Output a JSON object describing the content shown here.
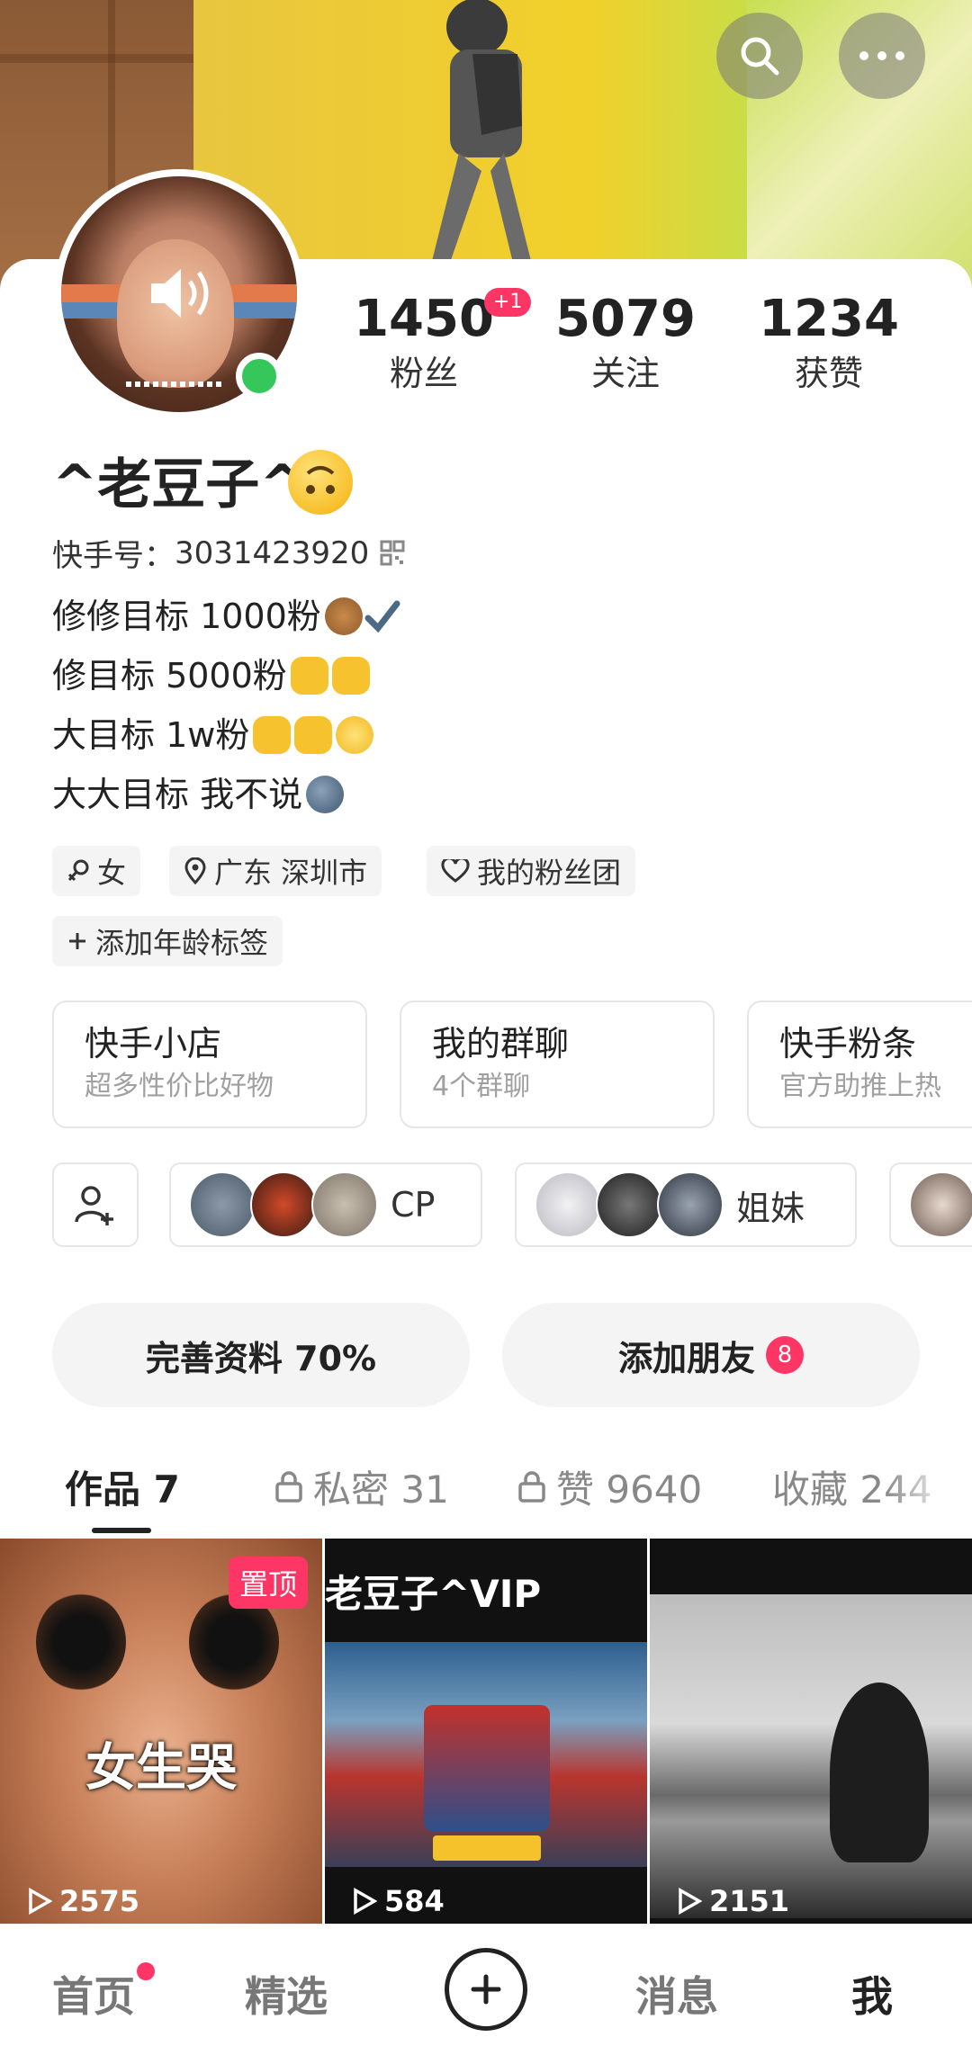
{
  "header": {
    "search_icon": "search-icon",
    "more_icon": "more-dots-icon"
  },
  "profile": {
    "nickname": "^老豆子^",
    "kuaishou_id_label": "快手号：",
    "kuaishou_id": "3031423920",
    "online": true
  },
  "stats": {
    "fans": {
      "value": "1450",
      "label": "粉丝",
      "badge": "+1"
    },
    "following": {
      "value": "5079",
      "label": "关注"
    },
    "likes": {
      "value": "1234",
      "label": "获赞"
    }
  },
  "bio": [
    "修修目标 1000粉",
    "修目标 5000粉",
    "大目标 1w粉",
    "大大目标 我不说"
  ],
  "tags": {
    "gender": "女",
    "location": "广东 深圳市",
    "fan_group": "我的粉丝团",
    "add_age": "添加年龄标签"
  },
  "services": [
    {
      "title": "快手小店",
      "subtitle": "超多性价比好物"
    },
    {
      "title": "我的群聊",
      "subtitle": "4个群聊"
    },
    {
      "title": "快手粉条",
      "subtitle": "官方助推上热"
    }
  ],
  "groups": [
    {
      "label": "CP"
    },
    {
      "label": "姐妹"
    }
  ],
  "actions": {
    "complete_profile": "完善资料 70%",
    "add_friends": "添加朋友",
    "add_friends_count": "8"
  },
  "tabs": [
    {
      "label": "作品 7",
      "locked": false,
      "active": true
    },
    {
      "label": "私密 31",
      "locked": true,
      "active": false
    },
    {
      "label": "赞 9640",
      "locked": true,
      "active": false
    },
    {
      "label": "收藏 244",
      "locked": false,
      "active": false
    }
  ],
  "videos": [
    {
      "pinned_label": "置顶",
      "caption": "女生哭",
      "plays": "2575"
    },
    {
      "caption": "老豆子^VIP",
      "plays": "584"
    },
    {
      "plays": "2151"
    }
  ],
  "bottom_nav": {
    "home": "首页",
    "featured": "精选",
    "messages": "消息",
    "me": "我"
  },
  "colors": {
    "accent": "#fe3666",
    "online": "#35c759",
    "text": "#222222",
    "muted": "#a0a0a0"
  }
}
